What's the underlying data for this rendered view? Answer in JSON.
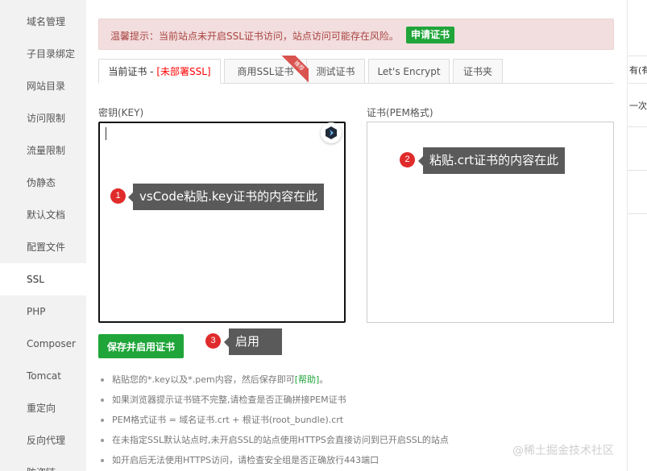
{
  "sidebar": {
    "items": [
      {
        "label": "域名管理"
      },
      {
        "label": "子目录绑定"
      },
      {
        "label": "网站目录"
      },
      {
        "label": "访问限制"
      },
      {
        "label": "流量限制"
      },
      {
        "label": "伪静态"
      },
      {
        "label": "默认文档"
      },
      {
        "label": "配置文件"
      },
      {
        "label": "SSL"
      },
      {
        "label": "PHP"
      },
      {
        "label": "Composer"
      },
      {
        "label": "Tomcat"
      },
      {
        "label": "重定向"
      },
      {
        "label": "反向代理"
      },
      {
        "label": "防盗链"
      }
    ],
    "active": "SSL"
  },
  "alert": {
    "text": "温馨提示：当前站点未开启SSL证书访问，站点访问可能存在风险。",
    "button": "申请证书"
  },
  "tabs": [
    {
      "label": "当前证书 - ",
      "warn": "[未部署SSL]"
    },
    {
      "label": "商用SSL证书",
      "ribbon": "推荐"
    },
    {
      "label": "测试证书"
    },
    {
      "label": "Let's Encrypt"
    },
    {
      "label": "证书夹"
    }
  ],
  "form": {
    "key_label": "密钥(KEY)",
    "cert_label": "证书(PEM格式)",
    "key_value": "",
    "cert_value": "",
    "save_button": "保存并启用证书"
  },
  "annotations": [
    {
      "num": "1",
      "text": "vsCode粘贴.key证书的内容在此"
    },
    {
      "num": "2",
      "text": "粘贴.crt证书的内容在此"
    },
    {
      "num": "3",
      "text": "启用"
    }
  ],
  "tips": {
    "t1_prefix": "粘贴您的*.key以及*.pem内容，然后保存即可",
    "t1_link": "[帮助]",
    "t1_suffix": "。",
    "t2": "如果浏览器提示证书链不完整,请检查是否正确拼接PEM证书",
    "t3": "PEM格式证书 = 域名证书.crt + 根证书(root_bundle).crt",
    "t4": "在未指定SSL默认站点时,未开启SSL的站点使用HTTPS会直接访问到已开启SSL的站点",
    "t5": "如开启后无法使用HTTPS访问，请检查安全组是否正确放行443端口"
  },
  "background": {
    "row1": "有(有个",
    "row2": "一次证"
  },
  "watermark": "@稀土掘金技术社区",
  "icons": {
    "extension": "extension-icon"
  },
  "colors": {
    "accent": "#20a53a",
    "alert_bg": "#f2dede",
    "alert_text": "#a94442",
    "marker": "#e02b2b",
    "callout": "#5a5a5a"
  }
}
